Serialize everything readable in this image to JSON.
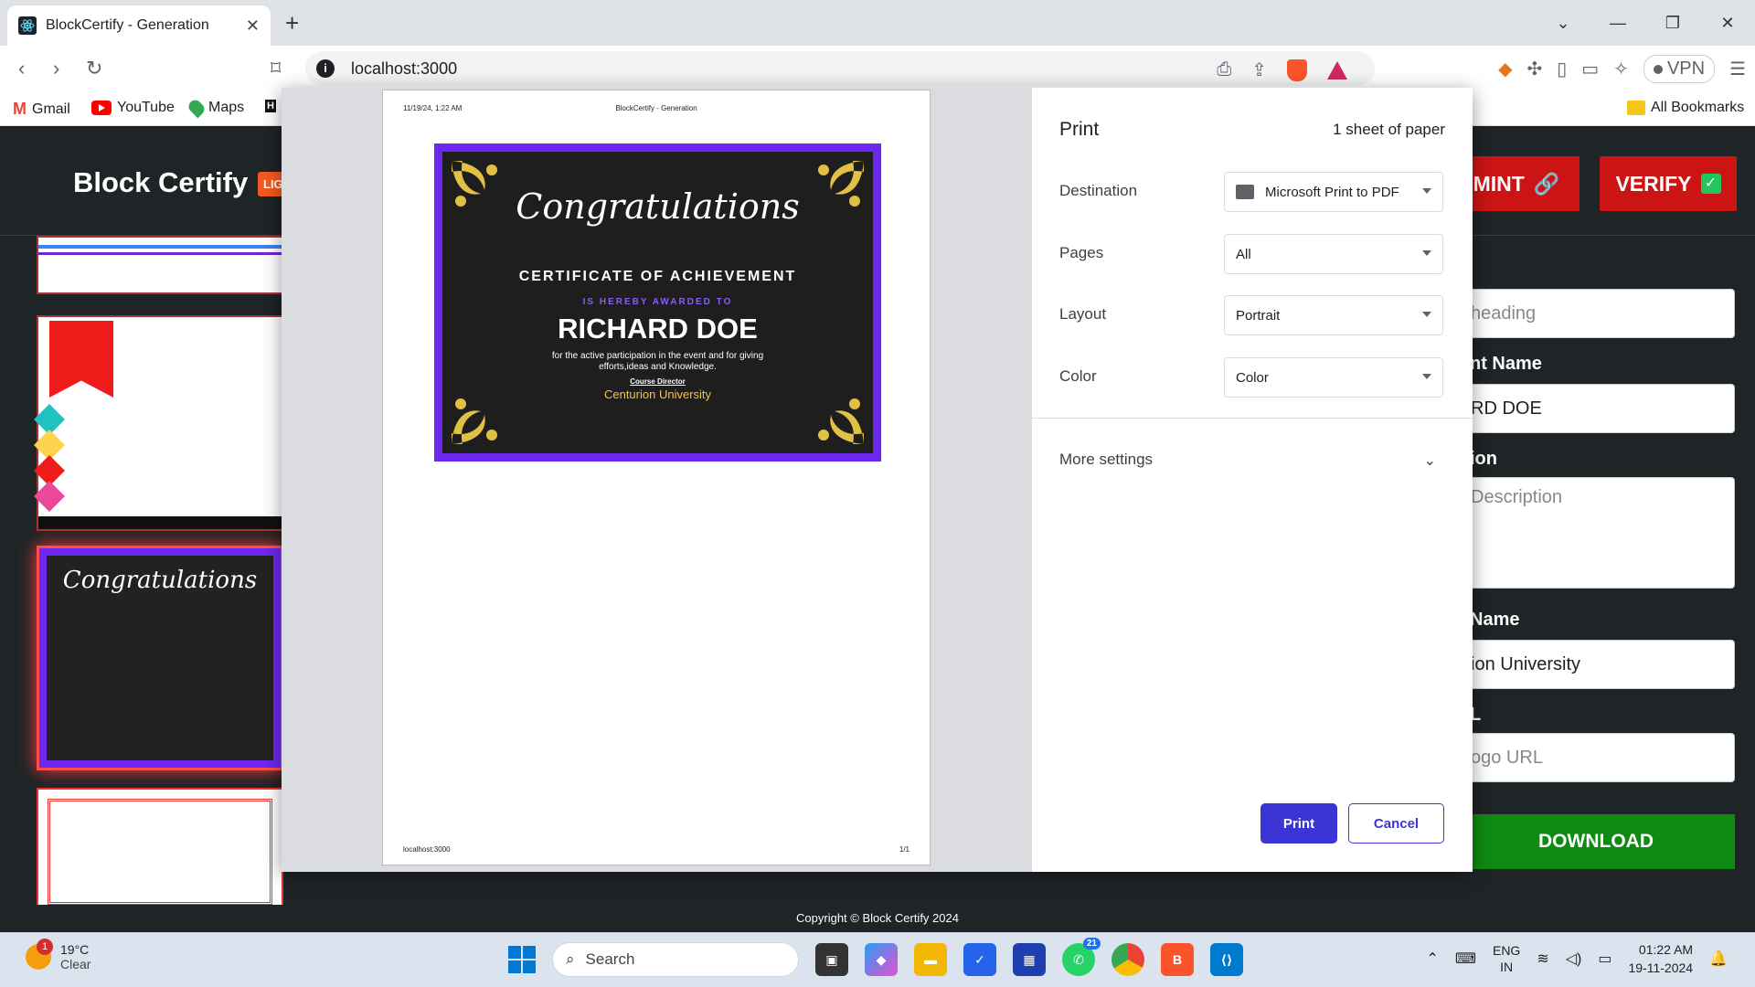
{
  "browser": {
    "tab_title": "BlockCertify - Generation",
    "url": "localhost:3000",
    "vpn_label": "VPN",
    "bookmarks": [
      {
        "label": "Gmail"
      },
      {
        "label": "YouTube"
      },
      {
        "label": "Maps"
      }
    ],
    "all_bookmarks": "All Bookmarks"
  },
  "site": {
    "logo": "Block Certify",
    "badge": "LIG",
    "mint_label": "MINT",
    "verify_label": "VERIFY",
    "form": {
      "heading_placeholder": "heading",
      "student_name_label": "nt Name",
      "student_name_value": "RD DOE",
      "description_label": "ion",
      "description_placeholder": "Description",
      "institute_label": "Name",
      "institute_value": "ion University",
      "logo_label": "L",
      "logo_placeholder": "ogo URL"
    },
    "download_label": "DOWNLOAD",
    "footer": "Copyright © Block Certify 2024"
  },
  "print_dialog": {
    "preview": {
      "header_left": "11/19/24, 1:22 AM",
      "header_center": "BlockCertify - Generation",
      "footer_left": "localhost:3000",
      "footer_right": "1/1",
      "certificate": {
        "congrats": "Congratulations",
        "title": "CERTIFICATE OF ACHIEVEMENT",
        "awarded": "IS HEREBY AWARDED TO",
        "name": "RICHARD DOE",
        "description": "for the active participation in the event and for giving efforts,ideas and Knowledge.",
        "director": "Course Director",
        "university": "Centurion University"
      }
    },
    "settings": {
      "title": "Print",
      "sheets": "1 sheet of paper",
      "destination_label": "Destination",
      "destination_value": "Microsoft Print to PDF",
      "pages_label": "Pages",
      "pages_value": "All",
      "layout_label": "Layout",
      "layout_value": "Portrait",
      "color_label": "Color",
      "color_value": "Color",
      "more_settings": "More settings",
      "print_button": "Print",
      "cancel_button": "Cancel"
    }
  },
  "taskbar": {
    "weather_temp": "19°C",
    "weather_desc": "Clear",
    "weather_badge": "1",
    "search_placeholder": "Search",
    "whatsapp_badge": "21",
    "lang_top": "ENG",
    "lang_bottom": "IN",
    "time": "01:22 AM",
    "date": "19-11-2024"
  },
  "colors": {
    "accent_red": "#cc1414",
    "download_green": "#0f8a12",
    "print_blue": "#3c35d6",
    "cert_purple": "#6d28f0",
    "cert_gold": "#f5c542"
  }
}
